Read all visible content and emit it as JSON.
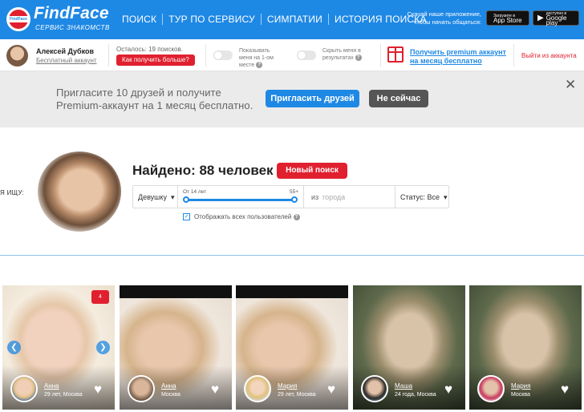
{
  "header": {
    "logo_badge": "FindFace",
    "logo": "FindFace",
    "tagline": "СЕРВИС ЗНАКОМСТВ",
    "nav": [
      "ПОИСК",
      "ТУР ПО СЕРВИСУ",
      "СИМПАТИИ",
      "ИСТОРИЯ ПОИСКА"
    ],
    "app_promo": "Скачай наше приложение, чтобы начать общаться:",
    "appstore_top": "Загрузите в",
    "appstore": "App Store",
    "googleplay_top": "доступно в",
    "googleplay": "Google play"
  },
  "account": {
    "name": "Алексей Дубков",
    "type": "Бесплатный аккаунт",
    "remaining": "Осталось: 19 поисков.",
    "get_more": "Как получить больше?",
    "toggle1": "Показывать меня на 1-ом месте",
    "toggle2": "Скрыть меня в результатах",
    "premium_link": "Получить premium аккаунт на месяц бесплатно",
    "logout": "Выйти из аккаунта"
  },
  "invite": {
    "text_line1": "Пригласите 10 друзей и получите",
    "text_line2": "Premium-аккаунт на 1 месяц бесплатно.",
    "invite_btn": "Пригласить друзей",
    "later_btn": "Не сейчас",
    "close": "✕"
  },
  "search": {
    "seek_label": "Я ИЩУ:",
    "found": "Найдено: 88 человек",
    "new_search": "Новый поиск",
    "gender": "Девушку",
    "age_from": "От 14 лет",
    "age_to": "55+",
    "from_label": "из",
    "city_placeholder": "города",
    "status": "Статус: Все",
    "show_all": "Отображать всех пользователей"
  },
  "results": [
    {
      "name": "Анна",
      "meta": "29 лет, Москва",
      "photos": "4"
    },
    {
      "name": "Анна",
      "meta": "Москва"
    },
    {
      "name": "Мария",
      "meta": "29 лет, Москва"
    },
    {
      "name": "Маша",
      "meta": "24 года, Москва"
    },
    {
      "name": "Мария",
      "meta": "Москва"
    }
  ],
  "colors": {
    "brand_blue": "#1e88e5",
    "accent_red": "#e0202f",
    "banner_gray": "#ebebeb"
  }
}
